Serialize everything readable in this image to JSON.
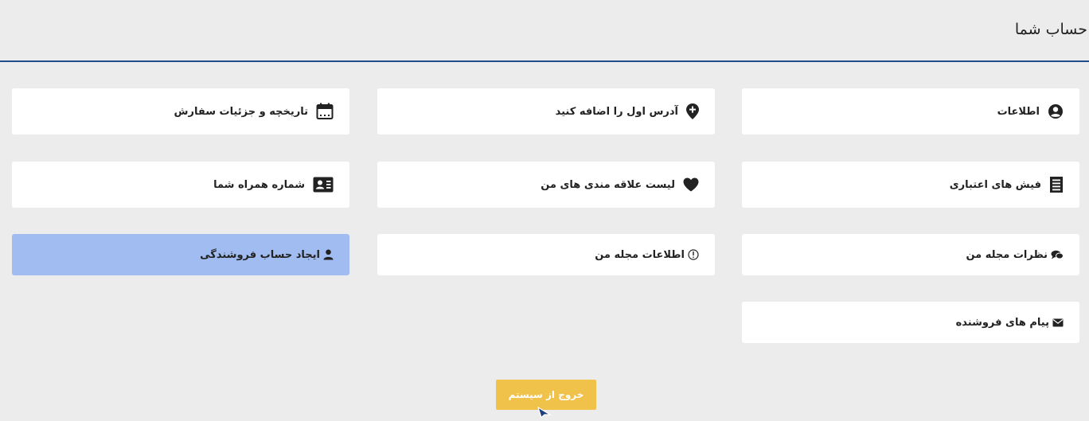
{
  "header": {
    "title": "حساب شما"
  },
  "cards": {
    "info": {
      "label": "اطلاعات",
      "icon": "user-circle-icon"
    },
    "add_address": {
      "label": "آدرس اول را اضافه کنید",
      "icon": "map-marker-plus-icon"
    },
    "order_history": {
      "label": "تاریخچه و جزئیات سفارش",
      "icon": "calendar-icon"
    },
    "credit_slips": {
      "label": "فیش های اعتباری",
      "icon": "receipt-icon"
    },
    "wishlist": {
      "label": "لیست علاقه مندی های من",
      "icon": "heart-icon"
    },
    "phone_number": {
      "label": "شماره همراه شما",
      "icon": "contact-card-icon"
    },
    "magazine_comments": {
      "label": "نظرات مجله من",
      "icon": "comments-icon"
    },
    "magazine_info": {
      "label": "اطلاعات مجله من",
      "icon": "info-circle-icon"
    },
    "create_seller": {
      "label": "ایجاد حساب فروشندگی",
      "icon": "user-icon"
    },
    "seller_messages": {
      "label": "پیام های فروشنده",
      "icon": "envelope-icon"
    }
  },
  "logout": {
    "label": "خروج از سیستم"
  },
  "colors": {
    "background": "#ececec",
    "card": "#ffffff",
    "highlight_card": "#a1bcf0",
    "logout_button": "#f1c24a",
    "header_rule": "#1f4e8c"
  }
}
